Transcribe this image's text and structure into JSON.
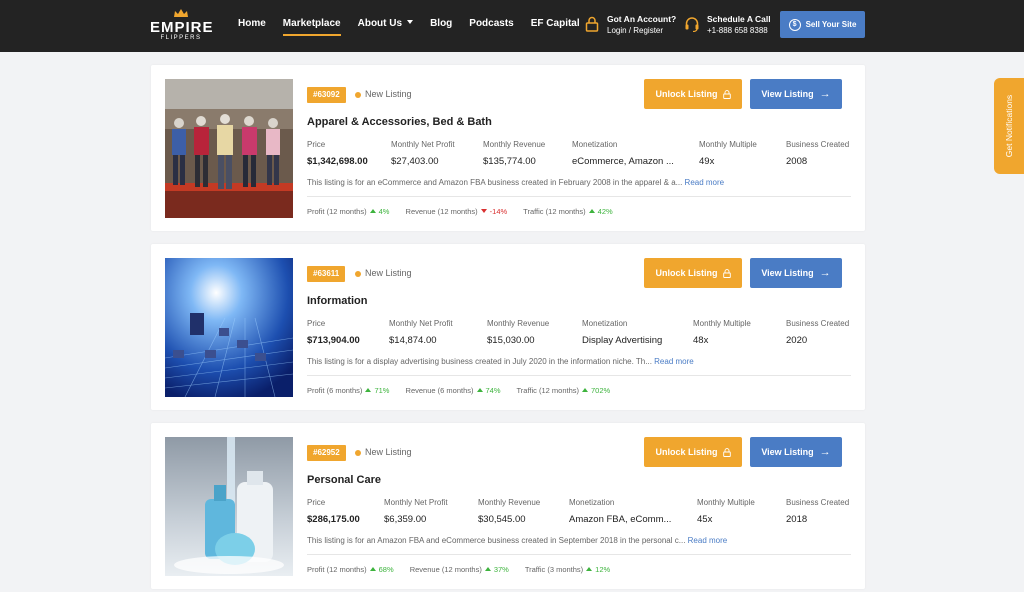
{
  "header": {
    "logo_main": "EMPIRE",
    "logo_sub": "FLIPPERS",
    "nav": [
      {
        "label": "Home"
      },
      {
        "label": "Marketplace"
      },
      {
        "label": "About Us"
      },
      {
        "label": "Blog"
      },
      {
        "label": "Podcasts"
      },
      {
        "label": "EF Capital"
      }
    ],
    "account_title": "Got An Account?",
    "account_sub": "Login / Register",
    "call_title": "Schedule A Call",
    "call_sub": "+1-888 658 8388",
    "sell_label": "Sell Your Site"
  },
  "notifications_tab": "Get Notifications",
  "listing_common": {
    "new_label": "New Listing",
    "unlock_label": "Unlock Listing",
    "view_label": "View Listing",
    "read_more": "Read more",
    "label_price": "Price",
    "label_profit": "Monthly Net Profit",
    "label_revenue": "Monthly Revenue",
    "label_monetization": "Monetization",
    "label_multiple": "Monthly Multiple",
    "label_created": "Business Created"
  },
  "listings": [
    {
      "id": "#63092",
      "title": "Apparel & Accessories, Bed & Bath",
      "price": "$1,342,698.00",
      "profit": "$27,403.00",
      "revenue": "$135,774.00",
      "monetization": "eCommerce, Amazon ...",
      "multiple": "49x",
      "created": "2008",
      "description": "This listing is for an eCommerce and Amazon FBA business created in February 2008 in the apparel & a...",
      "metrics": [
        {
          "label": "Profit (12 months)",
          "value": "4%",
          "trend": "up"
        },
        {
          "label": "Revenue (12 months)",
          "value": "-14%",
          "trend": "down"
        },
        {
          "label": "Traffic (12 months)",
          "value": "42%",
          "trend": "up"
        }
      ]
    },
    {
      "id": "#63611",
      "title": "Information",
      "price": "$713,904.00",
      "profit": "$14,874.00",
      "revenue": "$15,030.00",
      "monetization": "Display Advertising",
      "multiple": "48x",
      "created": "2020",
      "description": "This listing is for a display advertising business created in July 2020 in the information niche. Th...",
      "metrics": [
        {
          "label": "Profit (6 months)",
          "value": "71%",
          "trend": "up"
        },
        {
          "label": "Revenue (6 months)",
          "value": "74%",
          "trend": "up"
        },
        {
          "label": "Traffic (12 months)",
          "value": "702%",
          "trend": "up"
        }
      ]
    },
    {
      "id": "#62952",
      "title": "Personal Care",
      "price": "$286,175.00",
      "profit": "$6,359.00",
      "revenue": "$30,545.00",
      "monetization": "Amazon FBA, eComm...",
      "multiple": "45x",
      "created": "2018",
      "description": "This listing is for an Amazon FBA and eCommerce business created in September 2018 in the personal c...",
      "metrics": [
        {
          "label": "Profit (12 months)",
          "value": "68%",
          "trend": "up"
        },
        {
          "label": "Revenue (12 months)",
          "value": "37%",
          "trend": "up"
        },
        {
          "label": "Traffic (3 months)",
          "value": "12%",
          "trend": "up"
        }
      ]
    }
  ],
  "colors": {
    "header_bg": "#232323",
    "accent_orange": "#f0a62e",
    "accent_blue": "#4a7cc5",
    "trend_up": "#3db33d",
    "trend_down": "#d93030"
  }
}
